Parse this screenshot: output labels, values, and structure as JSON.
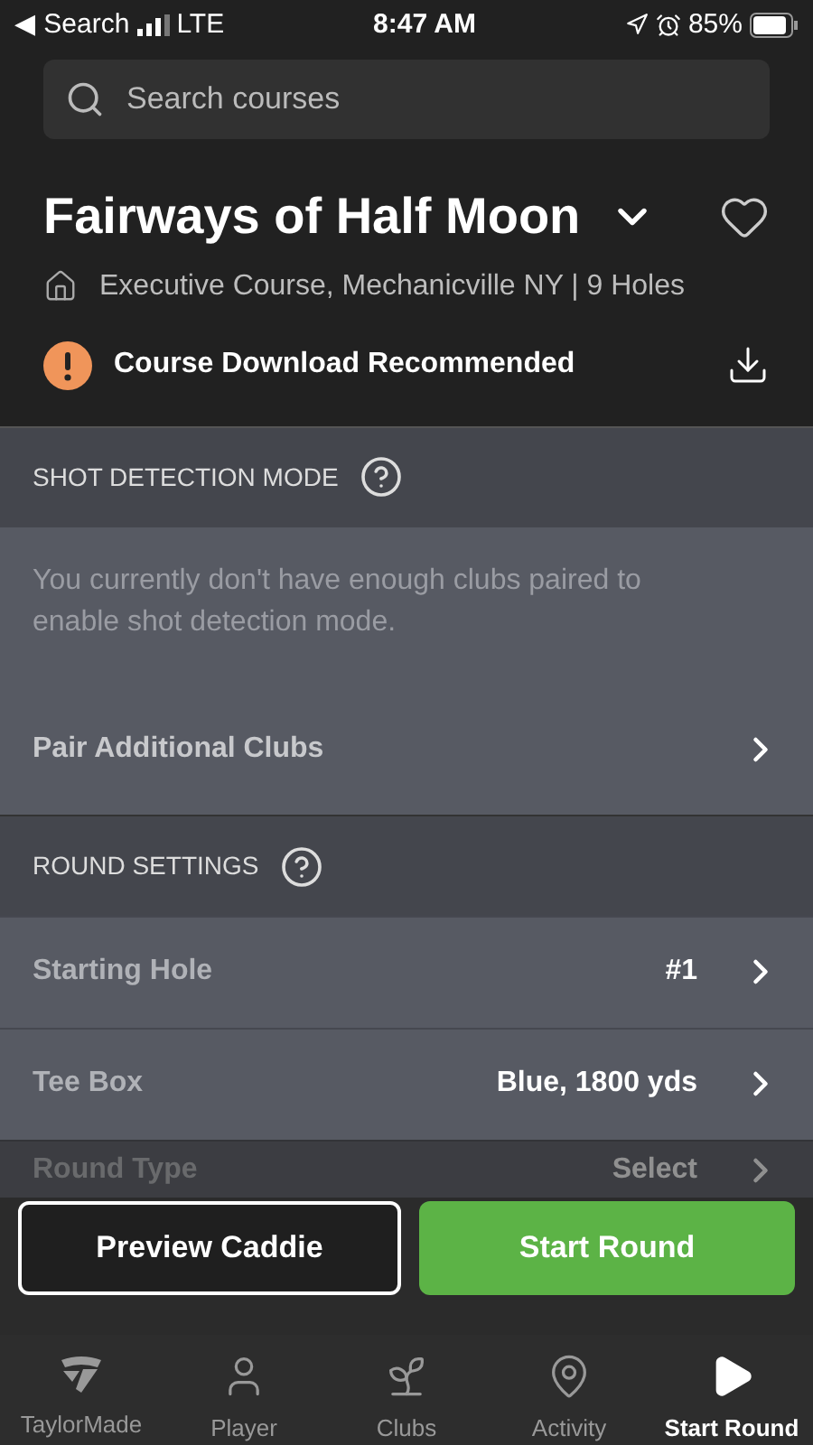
{
  "status_bar": {
    "back_label": "◀ Search",
    "network": "LTE",
    "time": "8:47 AM",
    "battery": "85%"
  },
  "search": {
    "placeholder": "Search courses"
  },
  "course": {
    "name": "Fairways of Half Moon",
    "details": "Executive Course, Mechanicville NY | 9 Holes",
    "alert": "Course Download Recommended",
    "favorite": false
  },
  "shot_detection": {
    "title": "SHOT DETECTION MODE",
    "message": "You currently don't have enough clubs paired to enable shot detection mode.",
    "link": "Pair Additional Clubs"
  },
  "round_settings": {
    "title": "ROUND SETTINGS",
    "rows": [
      {
        "label": "Starting Hole",
        "value": "#1"
      },
      {
        "label": "Tee Box",
        "value": "Blue, 1800 yds"
      },
      {
        "label": "Round Type",
        "value": "Select"
      }
    ]
  },
  "buttons": [
    {
      "label": "Preview Caddie",
      "kind": "secondary"
    },
    {
      "label": "Start Round",
      "kind": "primary"
    }
  ],
  "tabs": [
    {
      "label": "TaylorMade",
      "kind": "logo",
      "selected": false
    },
    {
      "label": "Player",
      "kind": "player",
      "selected": false
    },
    {
      "label": "Clubs",
      "kind": "sprout",
      "selected": false
    },
    {
      "label": "Activity",
      "kind": "pin",
      "selected": false
    },
    {
      "label": "Start Round",
      "kind": "play",
      "selected": true
    }
  ]
}
